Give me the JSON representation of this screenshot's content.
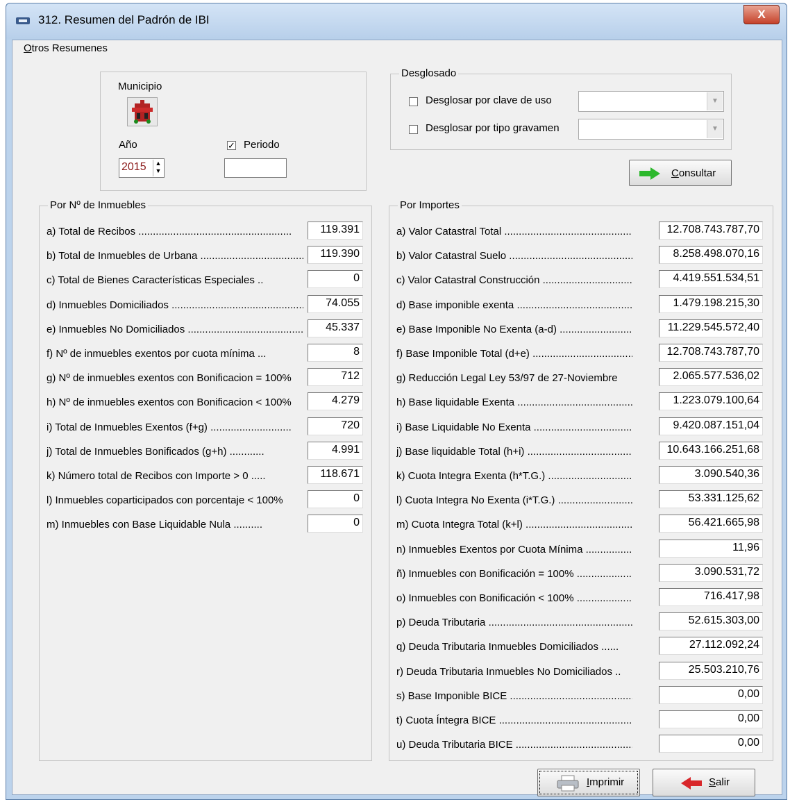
{
  "window": {
    "title": "312. Resumen del Padrón de IBI",
    "close": "X"
  },
  "menu": {
    "first": "O",
    "rest": "tros Resumenes"
  },
  "top_left": {
    "municipio_label": "Municipio",
    "anio_label": "Año",
    "anio_value": "2015",
    "periodo_label": "Periodo",
    "periodo_checked": true
  },
  "desglosado": {
    "legend": "Desglosado",
    "opt1_label": "Desglosar por clave de uso",
    "opt2_label": "Desglosar por tipo gravamen"
  },
  "consultar": {
    "first": "C",
    "rest": "onsultar"
  },
  "inmuebles": {
    "legend": "Por Nº de Inmuebles",
    "rows": [
      {
        "label": "a) Total de Recibos .....................................................",
        "value": "119.391"
      },
      {
        "label": "b) Total de Inmuebles de Urbana .......................................",
        "value": "119.390"
      },
      {
        "label": "c) Total de Bienes Características Especiales ..",
        "value": "0"
      },
      {
        "label": "d) Inmuebles Domiciliados ..........................................................",
        "value": "74.055"
      },
      {
        "label": "e) Inmuebles No Domiciliados ..................................................",
        "value": "45.337"
      },
      {
        "label": "f) Nº de inmuebles exentos por cuota mínima ...",
        "value": "8"
      },
      {
        "label": "g) Nº de inmuebles exentos con Bonificacion = 100%",
        "value": "712"
      },
      {
        "label": "h) Nº de inmuebles exentos con Bonificacion < 100%",
        "value": "4.279"
      },
      {
        "label": "i) Total de Inmuebles Exentos (f+g) ............................",
        "value": "720"
      },
      {
        "label": "j) Total de Inmuebles Bonificados (g+h) ............",
        "value": "4.991"
      },
      {
        "label": "k) Número total de Recibos con Importe > 0 .....",
        "value": "118.671"
      },
      {
        "label": "l) Inmuebles coparticipados con porcentaje < 100%",
        "value": "0"
      },
      {
        "label": "m) Inmuebles con Base Liquidable Nula ..........",
        "value": "0"
      }
    ]
  },
  "importes": {
    "legend": "Por Importes",
    "rows": [
      {
        "label": "a) Valor Catastral Total .............................................................",
        "value": "12.708.743.787,70"
      },
      {
        "label": "b) Valor Catastral Suelo ............................................................",
        "value": "8.258.498.070,16"
      },
      {
        "label": "c) Valor Catastral Construcción ................................................",
        "value": "4.419.551.534,51"
      },
      {
        "label": "d) Base imponible exenta ...........................................................",
        "value": "1.479.198.215,30"
      },
      {
        "label": "e) Base Imponible No Exenta (a-d) ...............................",
        "value": "11.229.545.572,40"
      },
      {
        "label": "f) Base Imponible Total (d+e) ...............................................",
        "value": "12.708.743.787,70"
      },
      {
        "label": "g) Reducción Legal Ley 53/97 de 27-Noviembre",
        "value": "2.065.577.536,02"
      },
      {
        "label": "h) Base liquidable Exenta ..........................................................",
        "value": "1.223.079.100,64"
      },
      {
        "label": "i) Base Liquidable No Exenta ..............................................",
        "value": "9.420.087.151,04"
      },
      {
        "label": "j) Base liquidable Total (h+i) ..................................................",
        "value": "10.643.166.251,68"
      },
      {
        "label": "k) Cuota Integra Exenta (h*T.G.) ...................................",
        "value": "3.090.540,36"
      },
      {
        "label": "l) Cuota Integra No Exenta (i*T.G.) ..........................",
        "value": "53.331.125,62"
      },
      {
        "label": "m) Cuota Integra Total (k+l) ................................................",
        "value": "56.421.665,98"
      },
      {
        "label": "n) Inmuebles Exentos por Cuota Mínima ....................",
        "value": "11,96"
      },
      {
        "label": "ñ) Inmuebles con Bonificación = 100% .....................",
        "value": "3.090.531,72"
      },
      {
        "label": "o) Inmuebles con Bonificación < 100% ......................",
        "value": "716.417,98"
      },
      {
        "label": "p) Deuda Tributaria ...............................................................",
        "value": "52.615.303,00"
      },
      {
        "label": "q) Deuda Tributaria Inmuebles Domiciliados ......",
        "value": "27.112.092,24"
      },
      {
        "label": "r) Deuda Tributaria Inmuebles No Domiciliados ..",
        "value": "25.503.210,76"
      },
      {
        "label": "s) Base Imponible BICE ..............................................................",
        "value": "0,00"
      },
      {
        "label": "t) Cuota Íntegra BICE ...............................................................",
        "value": "0,00"
      },
      {
        "label": "u) Deuda Tributaria BICE .........................................................",
        "value": "0,00"
      }
    ]
  },
  "imprimir": {
    "first": "I",
    "rest": "mprimir"
  },
  "salir": {
    "first": "S",
    "rest": "alir"
  },
  "colors": {
    "accent_green": "#2db82d",
    "exit_red": "#d8262a",
    "value_red": "#8b1a1a"
  }
}
